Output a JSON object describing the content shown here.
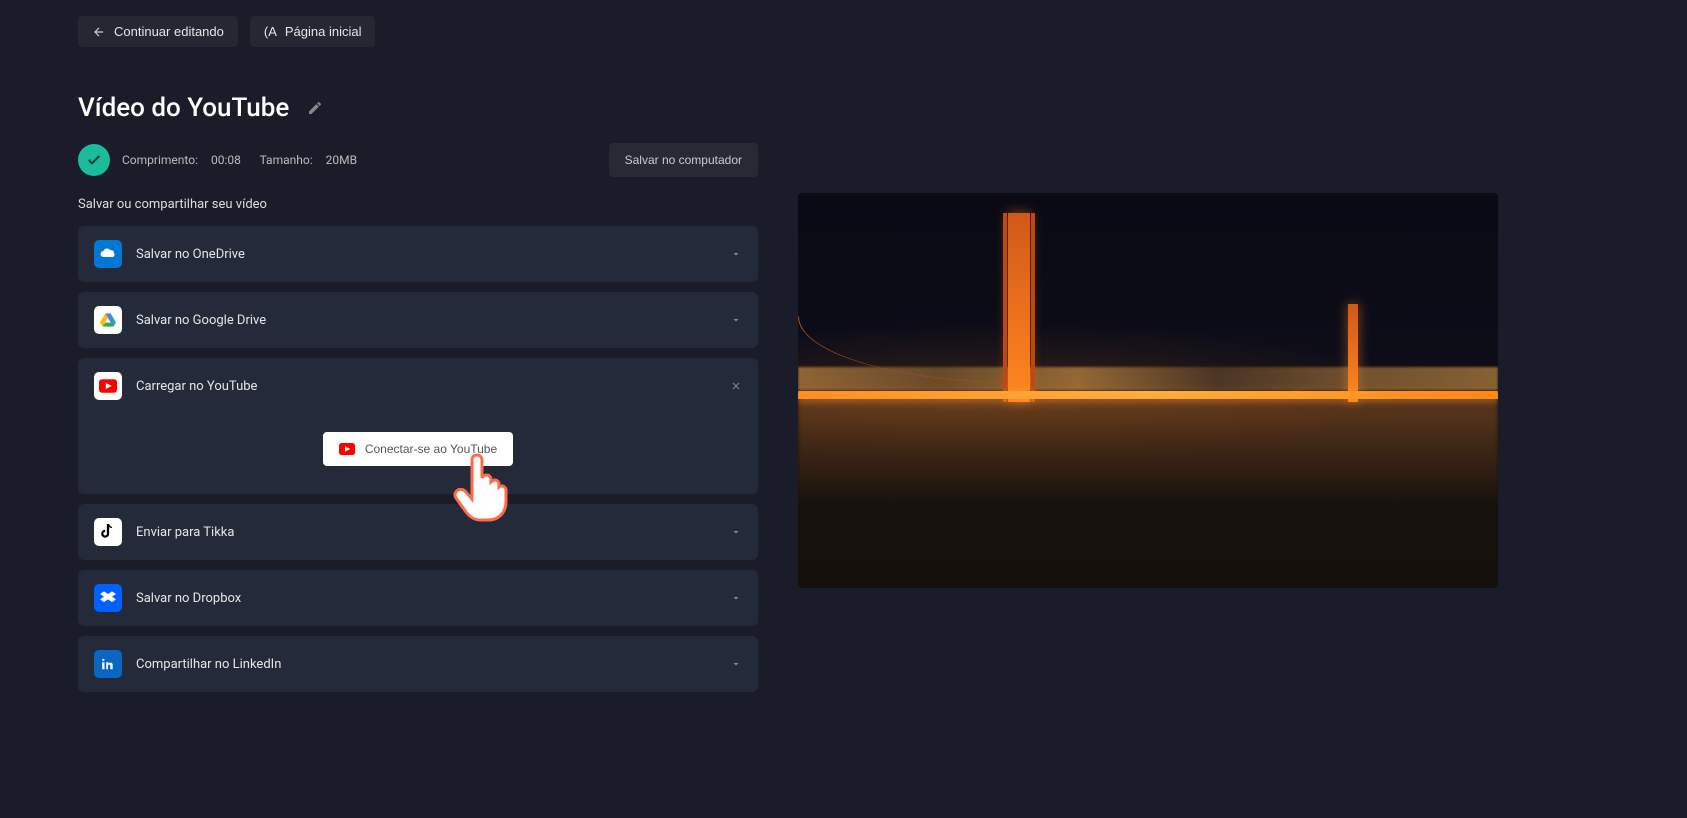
{
  "nav": {
    "continue_editing": "Continuar editando",
    "home_prefix": "(A",
    "home_label": "Página inicial"
  },
  "title": "Vídeo do YouTube",
  "status": {
    "length_label": "Comprimento:",
    "length_value": "00:08",
    "size_label": "Tamanho:",
    "size_value": "20MB"
  },
  "save_computer": "Salvar no computador",
  "section_label": "Salvar ou compartilhar seu vídeo",
  "share_options": {
    "onedrive": "Salvar no OneDrive",
    "googledrive": "Salvar no Google Drive",
    "youtube": "Carregar no YouTube",
    "tiktok": "Enviar para Tikka",
    "dropbox": "Salvar no Dropbox",
    "linkedin": "Compartilhar no LinkedIn"
  },
  "connect_youtube": "Conectar-se ao YouTube"
}
